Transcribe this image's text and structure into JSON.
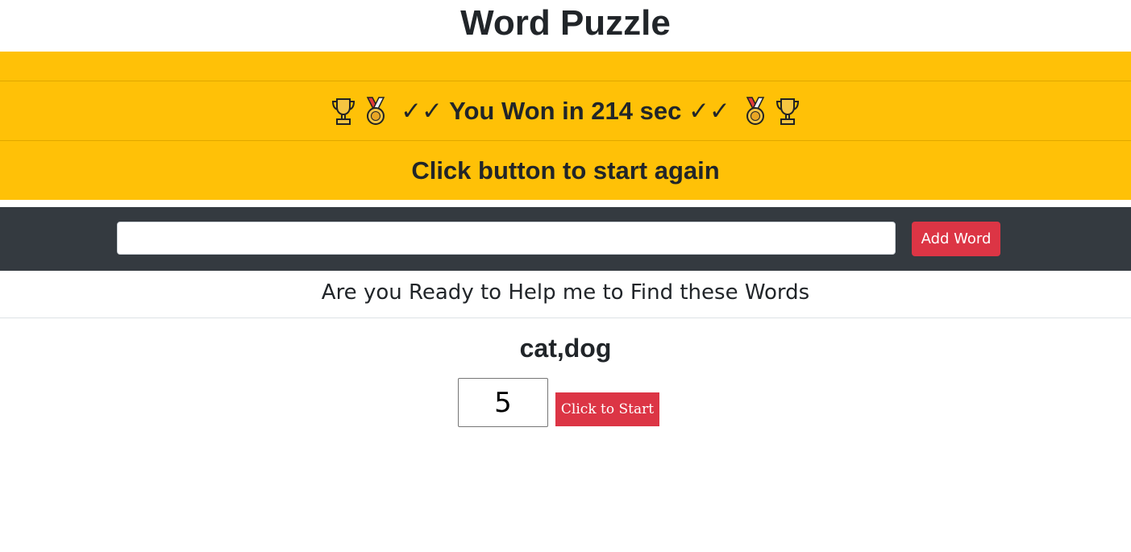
{
  "header": {
    "title": "Word Puzzle"
  },
  "banner": {
    "won_left_icons": [
      "trophy-icon",
      "medal-icon"
    ],
    "won_text": "✓✓ You Won in 214 sec ✓✓",
    "won_right_icons": [
      "medal-icon",
      "trophy-icon"
    ],
    "again_text": "Click button to start again",
    "color": "#ffc107"
  },
  "toolbar": {
    "word_input_value": "",
    "word_input_placeholder": "",
    "add_button_label": "Add Word",
    "color": "#343a40"
  },
  "prompt": {
    "text": "Are you Ready to Help me to Find these Words"
  },
  "game": {
    "words_text": "cat,dog",
    "grid_size_value": "5",
    "start_button_label": "Click to Start",
    "button_color": "#dc3545"
  }
}
